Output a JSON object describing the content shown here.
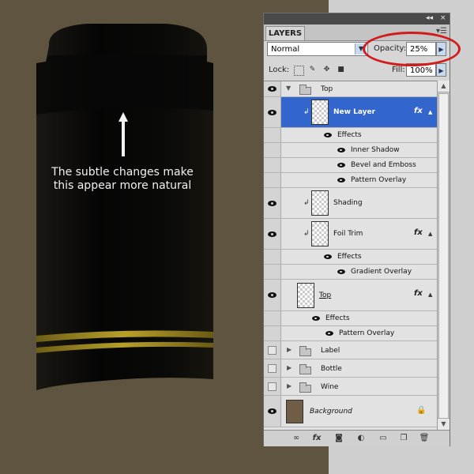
{
  "annotation": {
    "line1": "The subtle changes make",
    "line2": "this appear more natural"
  },
  "panel": {
    "tab_label": "LAYERS",
    "menu_icon": "panel-menu-icon",
    "collapse_glyph": "◂◂",
    "close_glyph": "×",
    "blend_mode": "Normal",
    "opacity_label": "Opacity:",
    "opacity_value": "25%",
    "lock_label": "Lock:",
    "fill_label": "Fill:",
    "fill_value": "100%"
  },
  "layers": {
    "group_top": "Top",
    "new_layer": "New Layer",
    "effects_1": "Effects",
    "inner_shadow": "Inner Shadow",
    "bevel_emboss": "Bevel and Emboss",
    "pattern_overlay_1": "Pattern Overlay",
    "shading": "Shading",
    "foil_trim": "Foil Trim",
    "effects_2": "Effects",
    "gradient_overlay": "Gradient Overlay",
    "top_layer": "Top",
    "effects_3": "Effects",
    "pattern_overlay_2": "Pattern Overlay",
    "label_group": "Label",
    "bottle_group": "Bottle",
    "wine_group": "Wine",
    "background": "Background",
    "fx": "fx"
  },
  "colors": {
    "canvas_bg": "#5f5440",
    "bottle": "#0b0a08",
    "foil_trim": "#a08a22",
    "selection": "#3366cc",
    "highlight_circle": "#d21b1b"
  }
}
